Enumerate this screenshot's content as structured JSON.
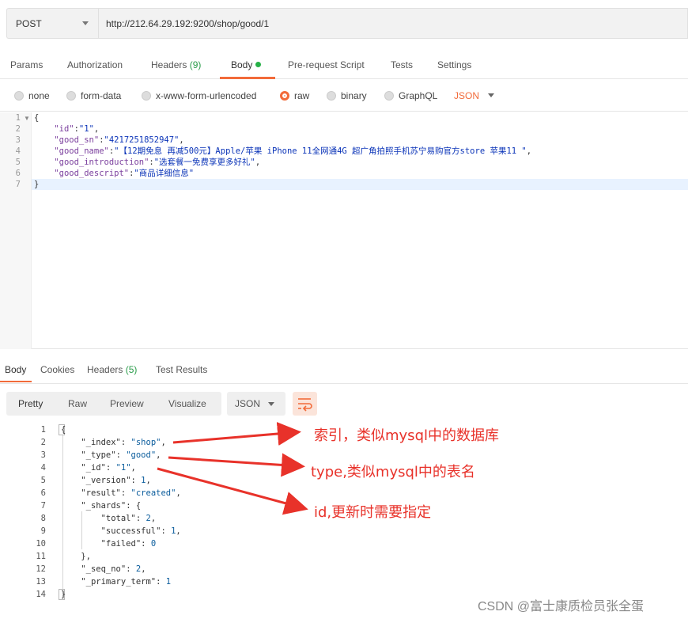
{
  "request": {
    "method": "POST",
    "url": "http://212.64.29.192:9200/shop/good/1"
  },
  "req_tabs": {
    "params": "Params",
    "authorization": "Authorization",
    "headers": "Headers",
    "headers_count": "(9)",
    "body": "Body",
    "prerequest": "Pre-request Script",
    "tests": "Tests",
    "settings": "Settings"
  },
  "body_types": {
    "none": "none",
    "form_data": "form-data",
    "urlencoded": "x-www-form-urlencoded",
    "raw": "raw",
    "binary": "binary",
    "graphql": "GraphQL",
    "format": "JSON",
    "selected": "raw"
  },
  "request_body": {
    "line_numbers": [
      "1",
      "2",
      "3",
      "4",
      "5",
      "6",
      "7"
    ],
    "open": "{",
    "close": "}",
    "fields": [
      {
        "key": "\"id\"",
        "value": "\"1\"",
        "sep": ","
      },
      {
        "key": "\"good_sn\"",
        "value": "\"4217251852947\"",
        "sep": ","
      },
      {
        "key": "\"good_name\"",
        "value": "\"【12期免息 再减500元】Apple/苹果 iPhone 11全网通4G 超广角拍照手机苏宁易购官方store 苹果11 \"",
        "sep": ","
      },
      {
        "key": "\"good_introduction\"",
        "value": "\"选套餐一免费享更多好礼\"",
        "sep": ","
      },
      {
        "key": "\"good_descript\"",
        "value": "\"商品详细信息\"",
        "sep": ""
      }
    ]
  },
  "resp_tabs": {
    "body": "Body",
    "cookies": "Cookies",
    "headers": "Headers",
    "headers_count": "(5)",
    "test_results": "Test Results"
  },
  "resp_view": {
    "pretty": "Pretty",
    "raw": "Raw",
    "preview": "Preview",
    "visualize": "Visualize",
    "format": "JSON"
  },
  "response_body": {
    "line_numbers": [
      "1",
      "2",
      "3",
      "4",
      "5",
      "6",
      "7",
      "8",
      "9",
      "10",
      "11",
      "12",
      "13",
      "14"
    ],
    "l1": "{",
    "l2_key": "\"_index\"",
    "l2_val": "\"shop\"",
    "l3_key": "\"_type\"",
    "l3_val": "\"good\"",
    "l4_key": "\"_id\"",
    "l4_val": "\"1\"",
    "l5_key": "\"_version\"",
    "l5_val": "1",
    "l6_key": "\"result\"",
    "l6_val": "\"created\"",
    "l7_key": "\"_shards\"",
    "l7_val": "{",
    "l8_key": "\"total\"",
    "l8_val": "2",
    "l9_key": "\"successful\"",
    "l9_val": "1",
    "l10_key": "\"failed\"",
    "l10_val": "0",
    "l11": "},",
    "l12_key": "\"_seq_no\"",
    "l12_val": "2",
    "l13_key": "\"_primary_term\"",
    "l13_val": "1",
    "l14": "}"
  },
  "annotations": {
    "index_note": "索引，类似mysql中的数据库",
    "type_note": "type,类似mysql中的表名",
    "id_note": "id,更新时需要指定"
  },
  "watermark": "CSDN @富士康质检员张全蛋",
  "colors": {
    "accent": "#f26b3a",
    "annotation": "#e8322a",
    "count_green": "#2a9c4a"
  }
}
